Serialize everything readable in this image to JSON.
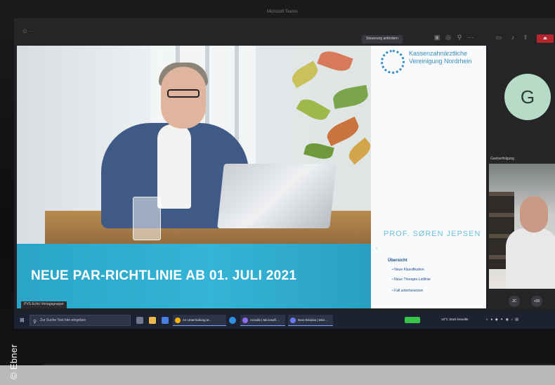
{
  "watermark": "© Ebner",
  "window": {
    "title": "Microsoft Teams"
  },
  "meeting": {
    "take_control_label": "Steuerung anfordern",
    "leave_label": "⏏"
  },
  "slide": {
    "logo_text": "Kassenzahnärztliche Vereinigung Nordrhein",
    "presenter_name": "PROF. SØREN JEPSEN",
    "banner_title": "NEUE PAR-RICHTLINIE AB 01. JULI 2021",
    "overview_heading": "Übersicht",
    "overview_items": [
      "Neue Klassifikation",
      "Neue Therapie-Leitlinie",
      "Fall unterbesetzen"
    ]
  },
  "presenter_tag": "PVS-Echo Verlagsgruppe",
  "participants": {
    "avatar_initial": "G",
    "camera_label": "Gastverfolgung",
    "controls": [
      "JC",
      "+20"
    ]
  },
  "taskbar": {
    "search_placeholder": "Zur Suche Text hier eingeben",
    "apps": [
      {
        "label": "An Unterhaltung te...",
        "color": "#f4b400"
      },
      {
        "label": "Annullo | Microsoft ...",
        "color": "#8f6cf0"
      },
      {
        "label": "New Window | Micr...",
        "color": "#6a7cf5"
      }
    ],
    "weather": "18°C  Stark bewölkt"
  }
}
